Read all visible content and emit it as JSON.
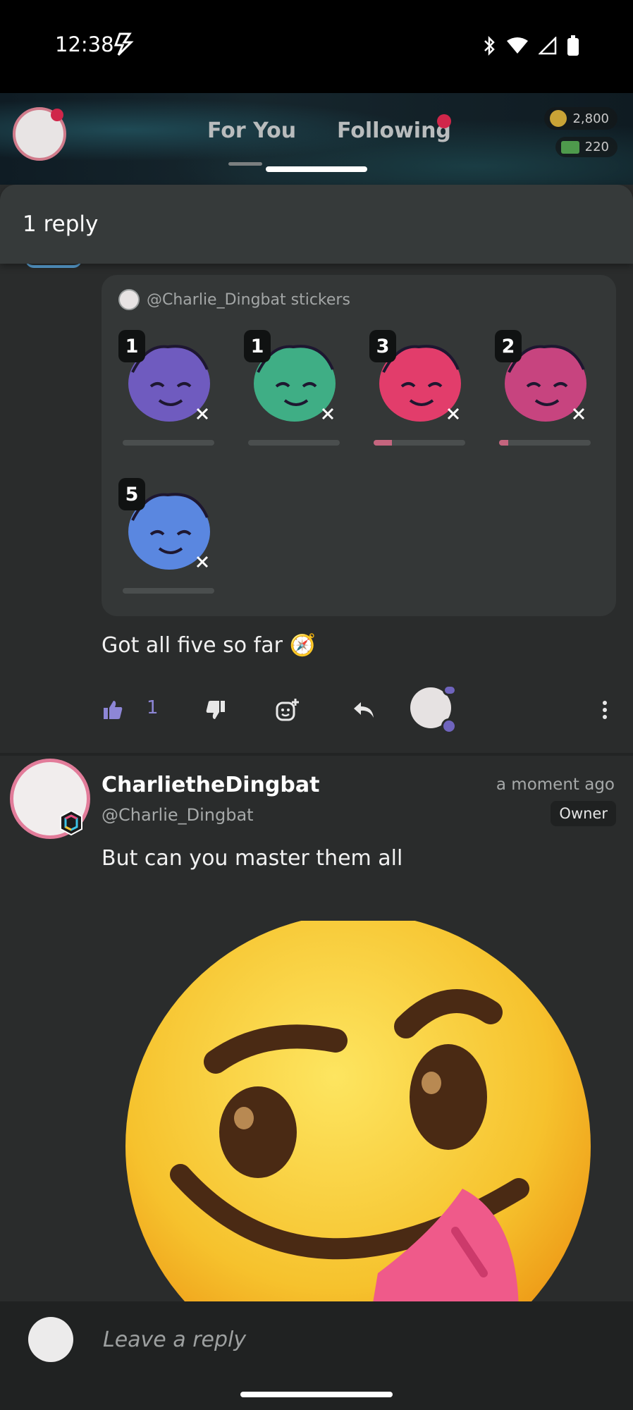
{
  "status_bar": {
    "time": "12:38",
    "icons": [
      "bolt-icon",
      "bluetooth-icon",
      "wifi-icon",
      "signal-icon",
      "battery-icon"
    ]
  },
  "header": {
    "tabs": [
      {
        "label": "For You"
      },
      {
        "label": "Following"
      }
    ],
    "coins": "2,800",
    "cash": "220"
  },
  "sheet": {
    "title": "1 reply"
  },
  "sticker_pack": {
    "title": "@Charlie_Dingbat stickers",
    "stickers": [
      {
        "count": "1",
        "color": "#6f5bbf",
        "progress": 0
      },
      {
        "count": "1",
        "color": "#3fae85",
        "progress": 0
      },
      {
        "count": "3",
        "color": "#e23d6b",
        "progress": 0.2
      },
      {
        "count": "2",
        "color": "#c7447f",
        "progress": 0.1
      },
      {
        "count": "5",
        "color": "#5a87e0",
        "progress": 0
      }
    ]
  },
  "comment": {
    "text": "Got all five so far 🧭",
    "likes": "1"
  },
  "post": {
    "username": "CharlietheDingbat",
    "handle": "@Charlie_Dingbat",
    "time": "a moment ago",
    "role": "Owner",
    "text": "But can you master them all"
  },
  "reply_bar": {
    "placeholder": "Leave a reply"
  },
  "colors": {
    "accent": "#8d86d6",
    "notification": "#d0264a",
    "avatar_ring": "#e27c9a"
  }
}
